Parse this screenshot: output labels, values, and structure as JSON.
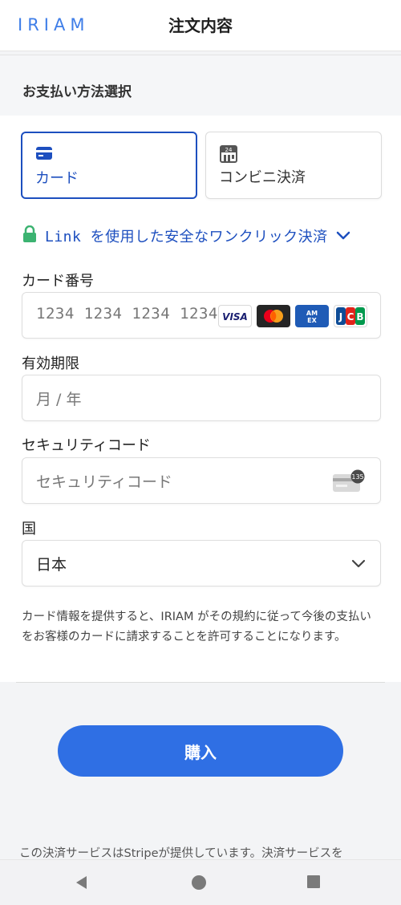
{
  "header": {
    "logo": "IRIAM",
    "title": "注文内容"
  },
  "payment": {
    "section_title": "お支払い方法選択",
    "methods": [
      {
        "label": "カード",
        "icon": "credit-card-icon",
        "selected": true
      },
      {
        "label": "コンビニ決済",
        "icon": "convenience-store-icon",
        "selected": false
      }
    ],
    "link_text": "Link を使用した安全なワンクリック決済"
  },
  "form": {
    "card_number": {
      "label": "カード番号",
      "placeholder": "1234 1234 1234 1234",
      "brands": [
        {
          "name": "VISA",
          "icon": "visa-icon"
        },
        {
          "name": "Mastercard",
          "icon": "mastercard-icon"
        },
        {
          "name": "AMEX",
          "icon": "amex-icon"
        },
        {
          "name": "JCB",
          "icon": "jcb-icon"
        }
      ]
    },
    "expiry": {
      "label": "有効期限",
      "placeholder": "月 / 年"
    },
    "cvc": {
      "label": "セキュリティコード",
      "placeholder": "セキュリティコード",
      "icon_badge": "135"
    },
    "country": {
      "label": "国",
      "value": "日本"
    },
    "terms": "カード情報を提供すると、IRIAM がその規約に従って今後の支払いをお客様のカードに請求することを許可することになります。"
  },
  "actions": {
    "buy_label": "購入"
  },
  "footer": {
    "text": "この決済サービスはStripeが提供しています。決済サービスを"
  },
  "colors": {
    "accent": "#1d4fbf",
    "button": "#2f6fe4",
    "lock": "#3cb371"
  }
}
